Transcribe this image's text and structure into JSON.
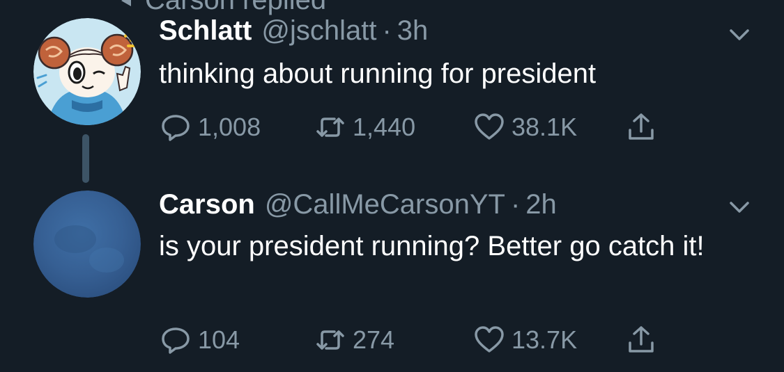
{
  "colors": {
    "background": "#141d26",
    "text_primary": "#ffffff",
    "text_secondary": "#8899a6",
    "thread_line": "#3d5466"
  },
  "context": {
    "label": "Carson replied"
  },
  "tweets": [
    {
      "name": "Schlatt",
      "handle": "@jschlatt",
      "separator": "·",
      "time": "3h",
      "text": "thinking about running for president",
      "avatar": "cartoon-ram-avatar",
      "stats": {
        "replies": "1,008",
        "retweets": "1,440",
        "likes": "38.1K"
      }
    },
    {
      "name": "Carson",
      "handle": "@CallMeCarsonYT",
      "separator": "·",
      "time": "2h",
      "text": "is your president running? Better go catch it!",
      "avatar": "blue-avatar",
      "stats": {
        "replies": "104",
        "retweets": "274",
        "likes": "13.7K"
      }
    }
  ]
}
